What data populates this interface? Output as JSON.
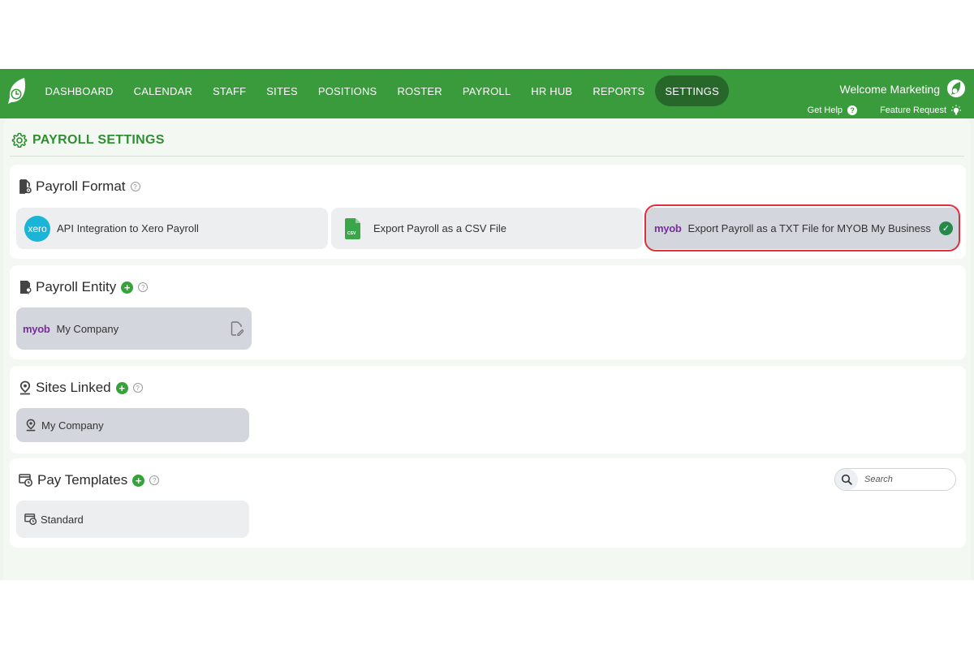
{
  "nav": {
    "items": [
      {
        "label": "DASHBOARD"
      },
      {
        "label": "CALENDAR"
      },
      {
        "label": "STAFF"
      },
      {
        "label": "SITES"
      },
      {
        "label": "POSITIONS"
      },
      {
        "label": "ROSTER"
      },
      {
        "label": "PAYROLL"
      },
      {
        "label": "HR HUB"
      },
      {
        "label": "REPORTS"
      },
      {
        "label": "SETTINGS",
        "active": true
      }
    ],
    "welcome": "Welcome Marketing",
    "get_help": "Get Help",
    "feature_request": "Feature Request"
  },
  "page": {
    "title": "PAYROLL SETTINGS"
  },
  "payroll_format": {
    "title": "Payroll Format",
    "options": [
      {
        "label": "API Integration to Xero Payroll",
        "logo": "xero"
      },
      {
        "label": "Export Payroll as a CSV File",
        "logo": "csv"
      },
      {
        "label": "Export Payroll as a TXT File for MYOB My Business",
        "logo": "myob",
        "selected": true
      }
    ]
  },
  "payroll_entity": {
    "title": "Payroll Entity",
    "items": [
      {
        "label": "My Company",
        "logo": "myob"
      }
    ]
  },
  "sites_linked": {
    "title": "Sites Linked",
    "items": [
      {
        "label": "My Company"
      }
    ]
  },
  "pay_templates": {
    "title": "Pay Templates",
    "search_placeholder": "Search",
    "items": [
      {
        "label": "Standard"
      }
    ]
  },
  "logos": {
    "xero": "xero",
    "csv": "CSV",
    "myob": "myob"
  },
  "colors": {
    "brand_green": "#3a9b3c",
    "nav_active": "#27682a",
    "title_green": "#2f8f32",
    "selection_red": "#e02f3c",
    "check_green": "#238a4a",
    "xero_blue": "#1ab4d7",
    "myob_purple": "#7b2b9e"
  }
}
